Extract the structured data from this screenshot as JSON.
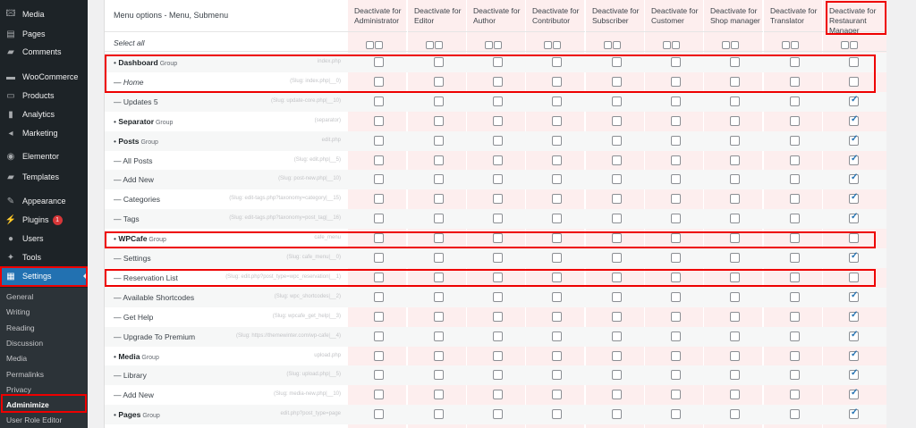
{
  "sidebar": {
    "items": [
      {
        "label": "Media",
        "icon": "media-icon",
        "glyph": "🖾"
      },
      {
        "label": "Pages",
        "icon": "pages-icon",
        "glyph": "▤"
      },
      {
        "label": "Comments",
        "icon": "comments-icon",
        "glyph": "▰"
      },
      {
        "label": "WooCommerce",
        "icon": "woocommerce-icon",
        "glyph": "▬"
      },
      {
        "label": "Products",
        "icon": "products-icon",
        "glyph": "▭"
      },
      {
        "label": "Analytics",
        "icon": "analytics-icon",
        "glyph": "▮"
      },
      {
        "label": "Marketing",
        "icon": "marketing-icon",
        "glyph": "◂"
      },
      {
        "label": "Elementor",
        "icon": "elementor-icon",
        "glyph": "◉"
      },
      {
        "label": "Templates",
        "icon": "templates-icon",
        "glyph": "▰"
      },
      {
        "label": "Appearance",
        "icon": "appearance-icon",
        "glyph": "✎"
      },
      {
        "label": "Plugins",
        "icon": "plugins-icon",
        "glyph": "⚡",
        "badge": "1"
      },
      {
        "label": "Users",
        "icon": "users-icon",
        "glyph": "●"
      },
      {
        "label": "Tools",
        "icon": "tools-icon",
        "glyph": "✦"
      },
      {
        "label": "Settings",
        "icon": "settings-icon",
        "glyph": "▦",
        "active": true
      }
    ],
    "submenu": [
      "General",
      "Writing",
      "Reading",
      "Discussion",
      "Media",
      "Permalinks",
      "Privacy",
      "Adminimize",
      "User Role Editor"
    ],
    "submenu_current": "Adminimize"
  },
  "table": {
    "header_menu": "Menu options - Menu, Submenu",
    "columns": [
      [
        "Deactivate for",
        "Administrator"
      ],
      [
        "Deactivate for",
        "Editor"
      ],
      [
        "Deactivate for",
        "Author"
      ],
      [
        "Deactivate for",
        "Contributor"
      ],
      [
        "Deactivate for",
        "Subscriber"
      ],
      [
        "Deactivate for",
        "Customer"
      ],
      [
        "Deactivate for",
        "Shop manager"
      ],
      [
        "Deactivate for",
        "Translator"
      ],
      [
        "Deactivate for",
        "Restaurant Manager"
      ]
    ],
    "select_all": "Select all",
    "rows": [
      {
        "prefix": "• ",
        "name": "Dashboard",
        "group": " Group",
        "slug": "index.php",
        "last_checked": false
      },
      {
        "prefix": "— ",
        "name": "Home",
        "italic": true,
        "slug": "(Slug: index.php|__0)",
        "last_checked": false
      },
      {
        "prefix": "— ",
        "name": "Updates 5",
        "slug": "(Slug: update-core.php|__10)",
        "last_checked": true
      },
      {
        "prefix": "• ",
        "name": "Separator",
        "group": " Group",
        "slug": "(separator)",
        "last_checked": true
      },
      {
        "prefix": "• ",
        "name": "Posts",
        "group": " Group",
        "slug": "edit.php",
        "last_checked": true
      },
      {
        "prefix": "— ",
        "name": "All Posts",
        "slug": "(Slug: edit.php|__5)",
        "last_checked": true
      },
      {
        "prefix": "— ",
        "name": "Add New",
        "slug": "(Slug: post-new.php|__10)",
        "last_checked": true
      },
      {
        "prefix": "— ",
        "name": "Categories",
        "slug": "(Slug: edit-tags.php?taxonomy=category|__15)",
        "last_checked": true
      },
      {
        "prefix": "— ",
        "name": "Tags",
        "slug": "(Slug: edit-tags.php?taxonomy=post_tag|__16)",
        "last_checked": true
      },
      {
        "prefix": "• ",
        "name": "WPCafe",
        "group": " Group",
        "slug": "cafe_menu",
        "last_checked": false
      },
      {
        "prefix": "— ",
        "name": "Settings",
        "slug": "(Slug: cafe_menu|__0)",
        "last_checked": true
      },
      {
        "prefix": "— ",
        "name": "Reservation List",
        "slug": "(Slug: edit.php?post_type=wpc_reservation|__1)",
        "last_checked": false
      },
      {
        "prefix": "— ",
        "name": "Available Shortcodes",
        "slug": "(Slug: wpc_shortcodes|__2)",
        "last_checked": true
      },
      {
        "prefix": "— ",
        "name": "Get Help",
        "slug": "(Slug: wpcafe_get_help|__3)",
        "last_checked": true
      },
      {
        "prefix": "— ",
        "name": "Upgrade To Premium",
        "slug": "(Slug: https://themewinter.com/wp-cafe|__4)",
        "last_checked": true
      },
      {
        "prefix": "• ",
        "name": "Media",
        "group": " Group",
        "slug": "upload.php",
        "last_checked": true
      },
      {
        "prefix": "— ",
        "name": "Library",
        "slug": "(Slug: upload.php|__5)",
        "last_checked": true
      },
      {
        "prefix": "— ",
        "name": "Add New",
        "slug": "(Slug: media-new.php|__10)",
        "last_checked": true
      },
      {
        "prefix": "• ",
        "name": "Pages",
        "group": " Group",
        "slug": "edit.php?post_type=page",
        "last_checked": true
      }
    ]
  },
  "colors": {
    "sidebar_bg": "#1d2327",
    "accent": "#2271b1",
    "highlight": "#e00000",
    "restricted_column_bg": "#fdeeee"
  }
}
